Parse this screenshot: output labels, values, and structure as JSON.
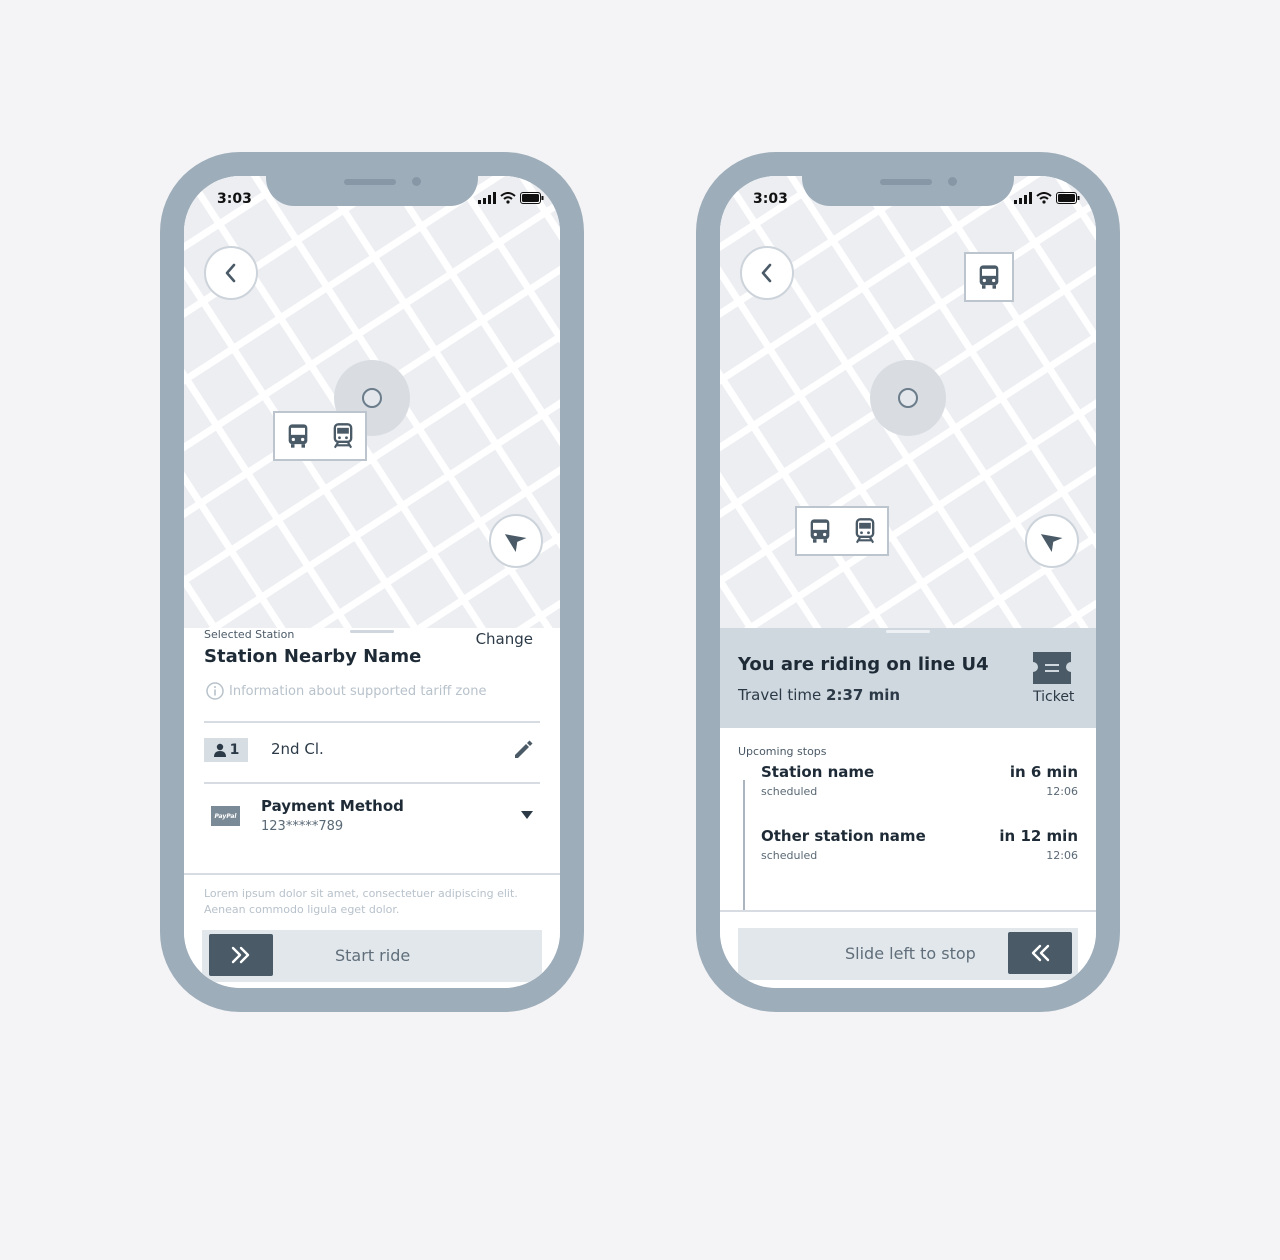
{
  "colors": {
    "frame": "#9eadba",
    "map_bg": "#eceef2",
    "accent_dark": "#4a5a67",
    "banner": "#cfd8df"
  },
  "left_phone": {
    "status_time": "3:03",
    "map": {
      "back_icon": "chevron-left-icon",
      "locate_icon": "navigation-arrow-icon",
      "marker_icons": [
        "bus-icon",
        "train-icon"
      ]
    },
    "sheet": {
      "label": "Selected Station",
      "station_name": "Station Nearby Name",
      "change_label": "Change",
      "info_text": "Information about supported tariff zone",
      "passengers": "1",
      "class_label": "2nd Cl.",
      "payment_badge": "PayPal",
      "payment_title": "Payment Method",
      "payment_number": "123*****789",
      "disclaimer": "Lorem ipsum dolor sit amet, consectetuer adipiscing elit. Aenean commodo ligula eget dolor.",
      "slider_label": "Start ride"
    }
  },
  "right_phone": {
    "status_time": "3:03",
    "map": {
      "back_icon": "chevron-left-icon",
      "locate_icon": "navigation-arrow-icon",
      "vehicle_icon": "bus-icon",
      "marker_icons": [
        "bus-icon",
        "train-icon"
      ]
    },
    "banner": {
      "title": "You are riding on line U4",
      "travel_prefix": "Travel time",
      "travel_value": "2:37 min",
      "ticket_label": "Ticket"
    },
    "upcoming_label": "Upcoming stops",
    "stops": [
      {
        "name": "Station name",
        "status": "scheduled",
        "eta": "in 6 min",
        "time": "12:06"
      },
      {
        "name": "Other station name",
        "status": "scheduled",
        "eta": "in 12 min",
        "time": "12:06"
      }
    ],
    "slider_label": "Slide left to stop"
  }
}
